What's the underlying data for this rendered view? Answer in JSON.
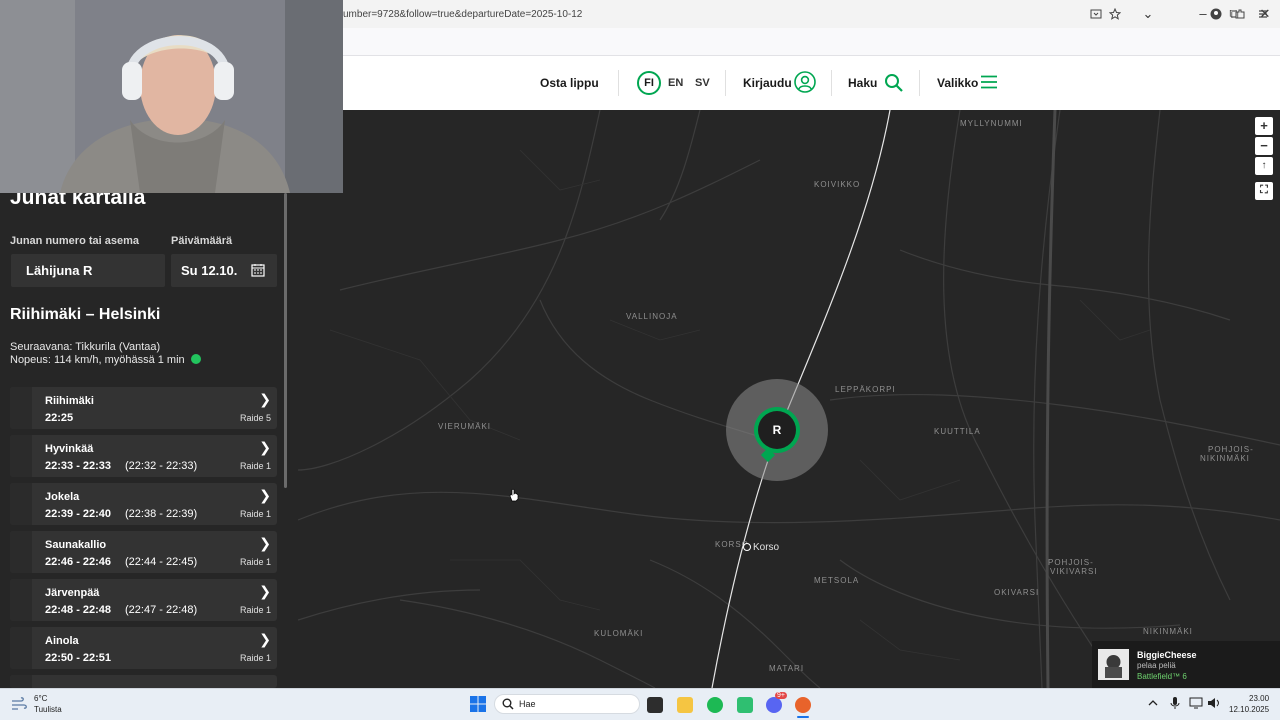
{
  "browser": {
    "url_partial": "umber=9728&follow=true&departureDate=2025-10-12",
    "window_controls": [
      "⌄",
      "–",
      "⧉",
      "✕"
    ]
  },
  "header": {
    "buy_ticket": "Osta lippu",
    "languages": [
      "FI",
      "EN",
      "SV"
    ],
    "login": "Kirjaudu",
    "search": "Haku",
    "menu": "Valikko"
  },
  "sidebar": {
    "title": "Junat kartalla",
    "train_label": "Junan numero tai asema",
    "date_label": "Päivämäärä",
    "train_value": "Lähijuna R",
    "date_value": "Su 12.10.",
    "route": "Riihimäki – Helsinki",
    "next_stop": "Seuraavana: Tikkurila (Vantaa)",
    "speed": "Nopeus: 114 km/h, myöhässä 1 min",
    "stops": [
      {
        "name": "Riihimäki",
        "time": "22:25",
        "scheduled": "",
        "track": "Raide 5"
      },
      {
        "name": "Hyvinkää",
        "time": "22:33 - 22:33",
        "scheduled": "(22:32 - 22:33)",
        "track": "Raide 1"
      },
      {
        "name": "Jokela",
        "time": "22:39 - 22:40",
        "scheduled": "(22:38 - 22:39)",
        "track": "Raide 1"
      },
      {
        "name": "Saunakallio",
        "time": "22:46 - 22:46",
        "scheduled": "(22:44 - 22:45)",
        "track": "Raide 1"
      },
      {
        "name": "Järvenpää",
        "time": "22:48 - 22:48",
        "scheduled": "(22:47 - 22:48)",
        "track": "Raide 1"
      },
      {
        "name": "Ainola",
        "time": "22:50 - 22:51",
        "scheduled": "",
        "track": "Raide 1"
      }
    ]
  },
  "map": {
    "labels": [
      "MYLLYNUMMI",
      "KOIVIKKO",
      "VALLINOJA",
      "LEPPÄKORPI",
      "VIERUMÄKI",
      "KUUTTILA",
      "POHJOIS-",
      "NIKINMÄKI",
      "KORSO",
      "METSOLA",
      "POHJOIS-",
      "VIKIVARSI",
      "OKIVARSI",
      "KULOMÄKI",
      "NIKINMÄKI",
      "MATARI"
    ],
    "station": "Korso",
    "train_marker": "R",
    "controls": [
      "+",
      "−",
      "↑",
      "⛶"
    ]
  },
  "taskbar": {
    "weather_temp": "6°C",
    "weather_desc": "Tuulista",
    "search": "Hae",
    "time": "23.00",
    "date": "12.10.2025",
    "chat_badge": "9+"
  },
  "notification": {
    "user": "BiggieCheese",
    "status": "pelaa peliä",
    "game": "Battlefield™ 6"
  }
}
